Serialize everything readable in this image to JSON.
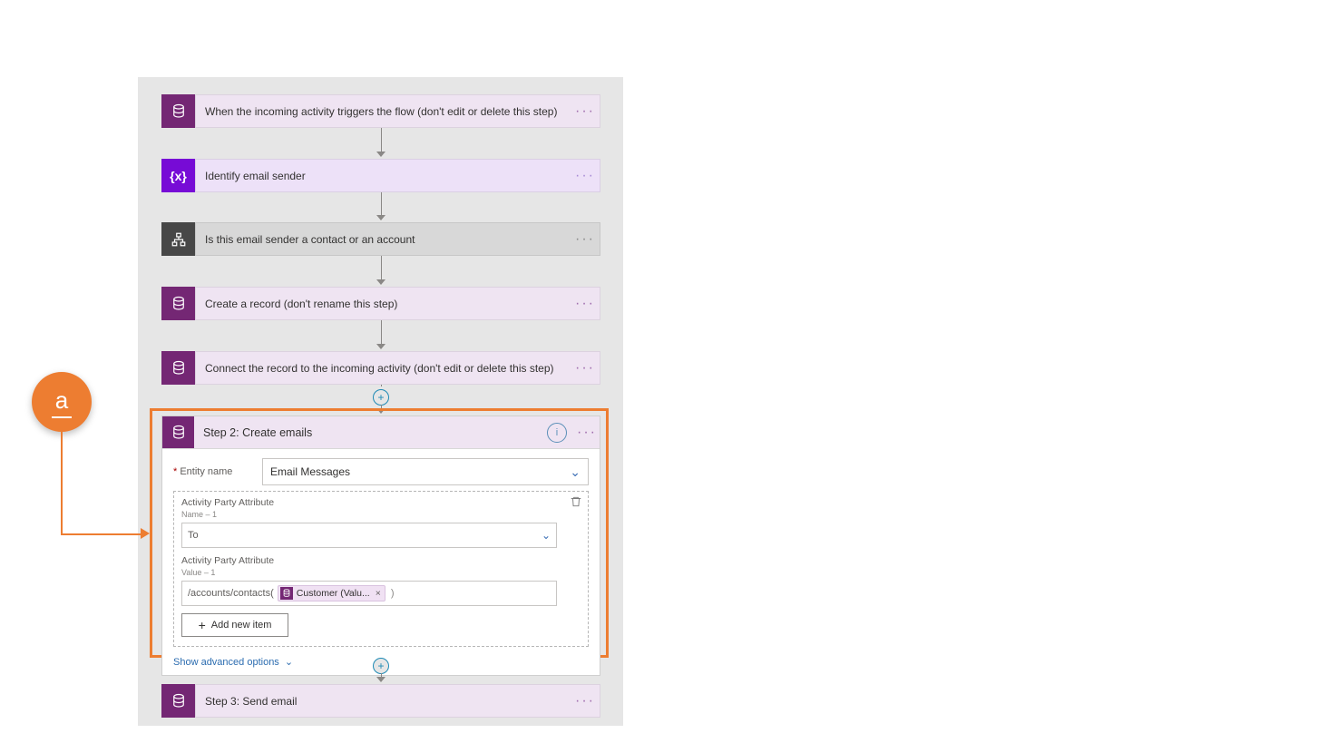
{
  "callout": {
    "letter": "a"
  },
  "steps": {
    "s1": {
      "label": "When the incoming activity triggers the flow (don't edit or delete this step)"
    },
    "s2": {
      "label": "Identify email sender"
    },
    "s3": {
      "label": "Is this email sender a contact or an account"
    },
    "s4": {
      "label": "Create a record (don't rename this step)"
    },
    "s5": {
      "label": "Connect the record to the incoming activity (don't edit or delete this step)"
    },
    "s7": {
      "label": "Step 3: Send email"
    }
  },
  "card": {
    "title": "Step 2: Create emails",
    "entity_label": "Entity name",
    "entity_value": "Email Messages",
    "ap_name_label": "Activity Party Attribute",
    "ap_name_sub": "Name – 1",
    "ap_name_value": "To",
    "ap_value_label": "Activity Party Attribute",
    "ap_value_sub": "Value – 1",
    "ap_value_prefix": "/accounts/contacts(",
    "ap_token": "Customer (Valu...",
    "ap_value_suffix": ")",
    "add_item": "Add new item",
    "show_adv": "Show advanced options"
  }
}
